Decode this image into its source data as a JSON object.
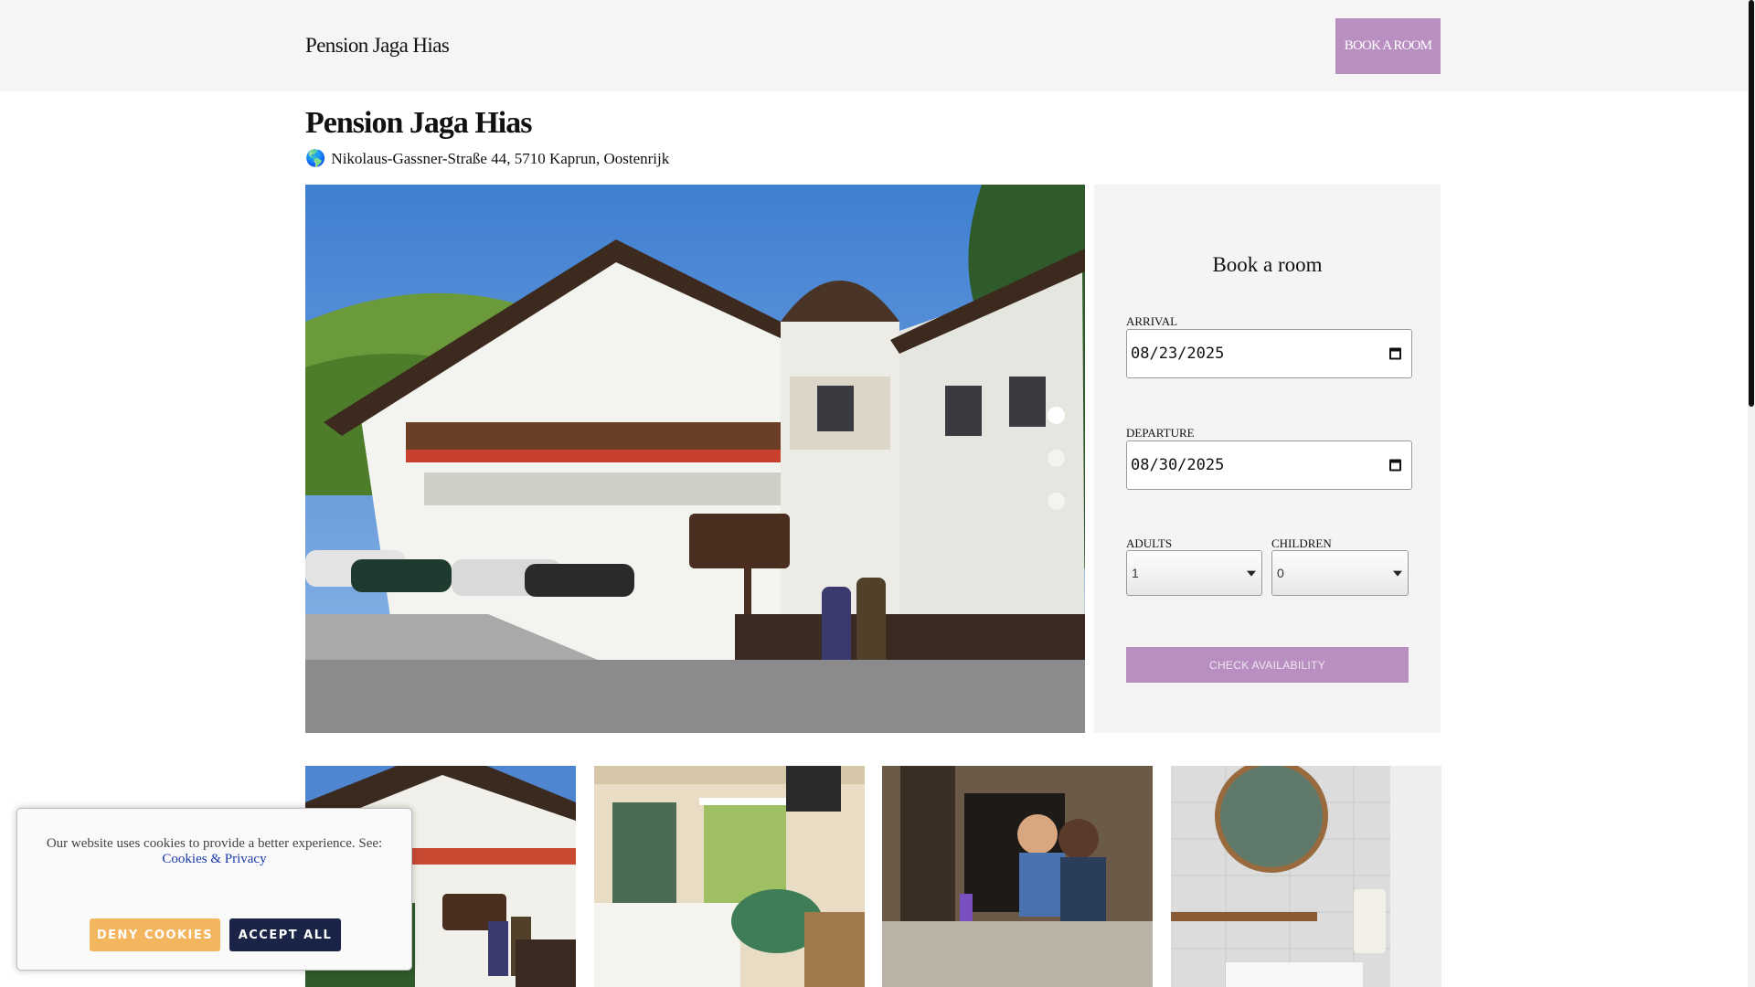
{
  "header": {
    "brand": "Pension Jaga Hias",
    "book_button": "BOOK A ROOM"
  },
  "property": {
    "title": "Pension Jaga Hias",
    "globe_icon": "🌎",
    "address": "Nikolaus-Gassner-Straße 44, 5710 Kaprun, Oostenrijk"
  },
  "carousel": {
    "slides": 3,
    "active_index": 0
  },
  "booking": {
    "title": "Book a room",
    "arrival_label": "ARRIVAL",
    "arrival_value": "08/23/2025",
    "departure_label": "DEPARTURE",
    "departure_value": "08/30/2025",
    "adults_label": "ADULTS",
    "adults_value": "1",
    "children_label": "CHILDREN",
    "children_value": "0",
    "check_button": "CHECK AVAILABILITY"
  },
  "cookie": {
    "text": "Our website uses cookies to provide a better experience. See:",
    "link": "Cookies & Privacy",
    "deny": "DENY COOKIES",
    "accept": "ACCEPT ALL"
  },
  "colors": {
    "accent": "#b88fc0",
    "cookie_deny": "#f4b55f",
    "cookie_accept": "#1a2446"
  }
}
